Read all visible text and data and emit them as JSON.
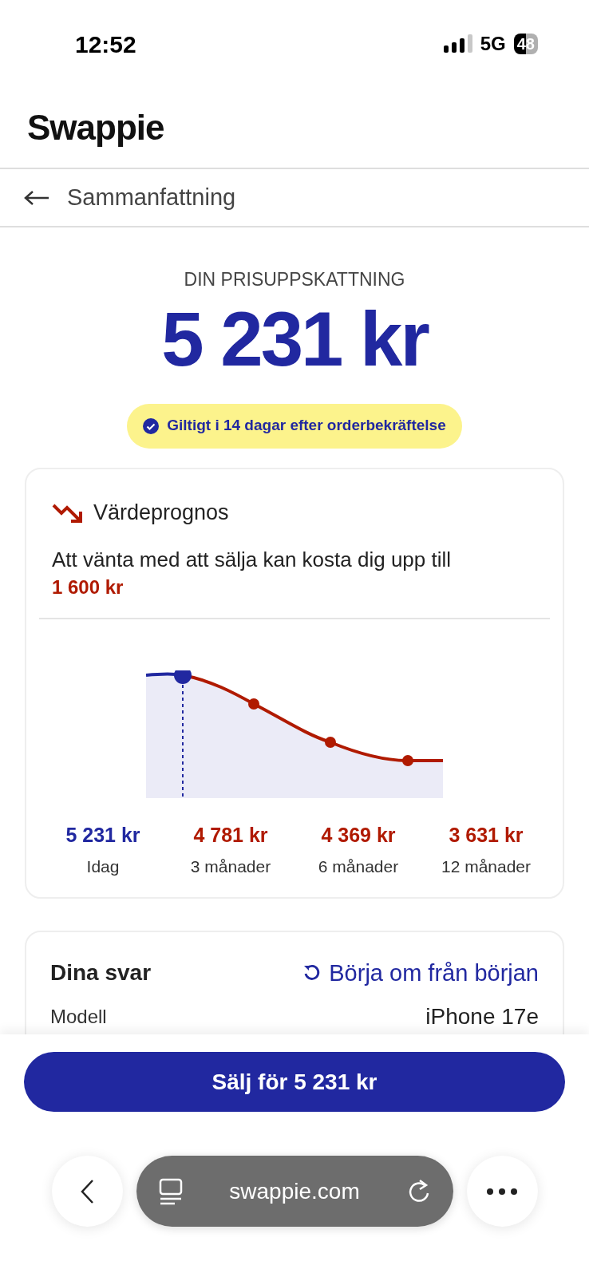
{
  "status_bar": {
    "time": "12:52",
    "network": "5G",
    "battery": "48"
  },
  "header": {
    "logo": "Swappie"
  },
  "nav": {
    "title": "Sammanfattning"
  },
  "estimate": {
    "label": "DIN PRISUPPSKATTNING",
    "price": "5 231 kr",
    "badge": "Giltigt i 14 dagar efter orderbekräftelse"
  },
  "forecast": {
    "title": "Värdeprognos",
    "text": "Att vänta med att sälja kan kosta dig upp till",
    "amount": "1 600 kr",
    "points": [
      {
        "price": "5 231 kr",
        "label": "Idag",
        "selected": true
      },
      {
        "price": "4 781 kr",
        "label": "3 månader",
        "selected": false
      },
      {
        "price": "4 369 kr",
        "label": "6 månader",
        "selected": false
      },
      {
        "price": "3 631 kr",
        "label": "12 månader",
        "selected": false
      }
    ]
  },
  "answers": {
    "title": "Dina svar",
    "restart": "Börja om från början",
    "rows": [
      {
        "label": "Modell",
        "value": "iPhone 17e"
      }
    ]
  },
  "sell_button": "Sälj för 5 231 kr",
  "browser": {
    "url": "swappie.com"
  }
}
